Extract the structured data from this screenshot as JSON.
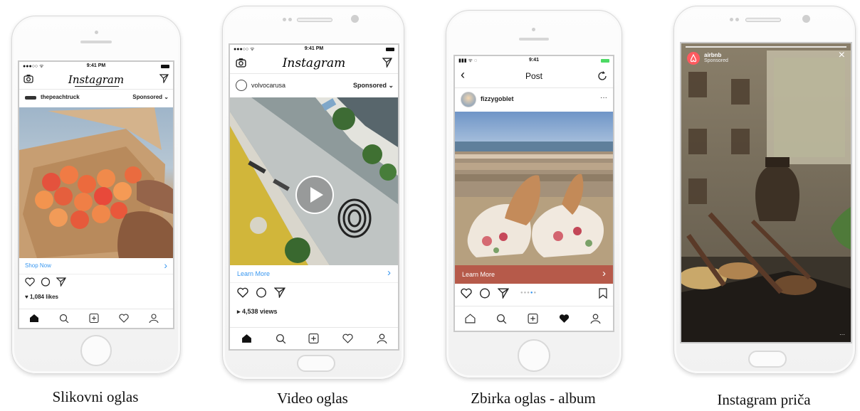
{
  "ad1": {
    "time": "9:41 PM",
    "logo": "Instagram",
    "username": "thepeachtruck",
    "sponsored": "Sponsored ⌄",
    "cta": "Shop Now",
    "cta_arrow": "›",
    "likes": "♥ 1,084 likes"
  },
  "ad2": {
    "time": "9:41 PM",
    "logo": "Instagram",
    "username": "volvocarusa",
    "sponsored": "Sponsored ⌄",
    "cta": "Learn More",
    "cta_arrow": "›",
    "views": "▸ 4,538 views"
  },
  "ad3": {
    "time": "9:41",
    "title": "Post",
    "username": "fizzygoblet",
    "more": "···",
    "cta": "Learn More",
    "cta_arrow": "›"
  },
  "ad4": {
    "username": "airbnb",
    "sponsored": "Sponsored",
    "close": "×",
    "more": "···"
  },
  "captions": [
    "Slikovni oglas",
    "Video oglas",
    "Zbirka oglas - album",
    "Instagram priča"
  ],
  "colors": {
    "accent_blue": "#3897f0",
    "cta_brown": "#b65a4a",
    "airbnb": "#ff5a5f"
  }
}
